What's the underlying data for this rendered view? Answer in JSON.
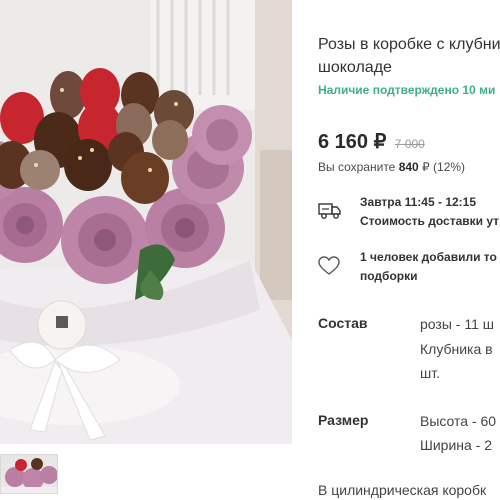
{
  "product": {
    "title_line1": "Розы в коробке с клубни",
    "title_line2": "шоколаде",
    "availability": "Наличие подтверждено 10 ми",
    "price": "6 160 ₽",
    "old_price": "7 000",
    "savings_prefix": "Вы сохраните ",
    "savings_amount": "840",
    "savings_suffix": " ₽ (12%)"
  },
  "delivery": {
    "icon": "delivery-truck-icon",
    "when": "Завтра 11:45 - 12:15",
    "cost_label": "Стоимость доставки ут"
  },
  "favorites": {
    "icon": "heart-icon",
    "line1": "1 человек добавили то",
    "line2": "подборки"
  },
  "specs": {
    "composition_label": "Состав",
    "composition_line1": "розы - 11 ш",
    "composition_line2": "Клубника в",
    "composition_line3": "шт.",
    "size_label": "Размер",
    "size_line1": "Высота - 60",
    "size_line2": "Ширина - 2"
  },
  "description": "В цилиндрическая коробк",
  "colors": {
    "accent_green": "#3eae8e",
    "rose": "#b77aa0",
    "chocolate": "#5a3420",
    "strawberry": "#c8262e",
    "box": "#f2eef1"
  }
}
